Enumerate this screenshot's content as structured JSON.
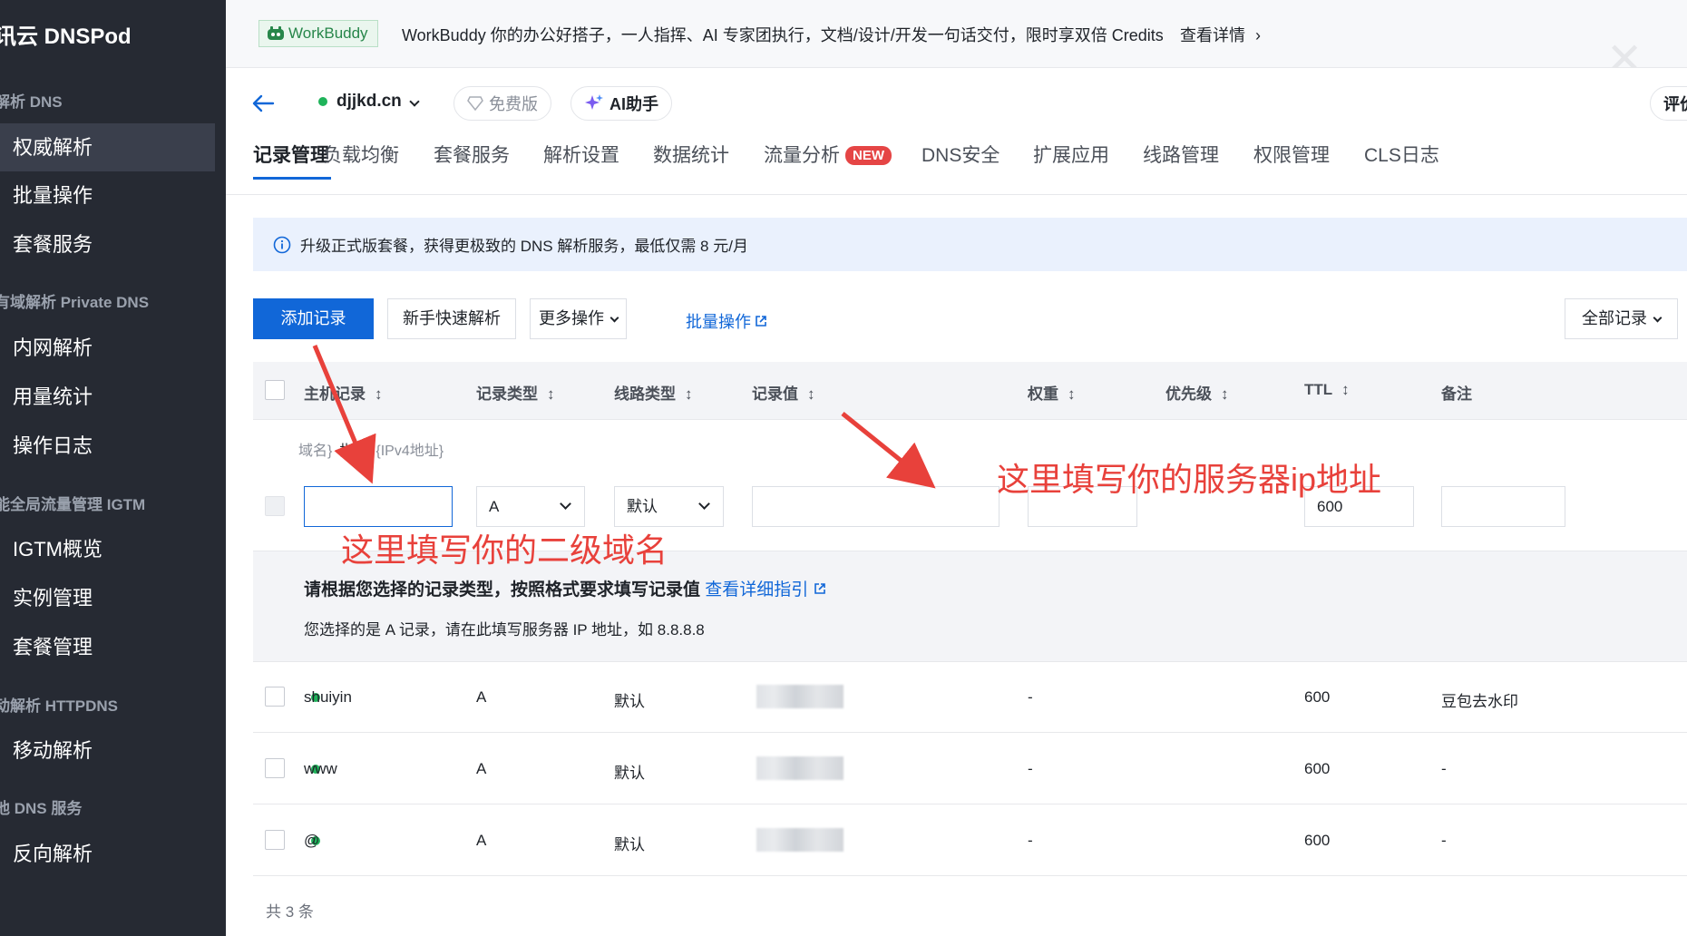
{
  "sidebar": {
    "title": "讯云 DNSPod",
    "groups": [
      {
        "label": "解析 DNS",
        "items": [
          {
            "label": "权威解析",
            "active": true
          },
          {
            "label": "批量操作"
          },
          {
            "label": "套餐服务"
          }
        ]
      },
      {
        "label": "有域解析 Private DNS",
        "items": [
          {
            "label": "内网解析"
          },
          {
            "label": "用量统计"
          },
          {
            "label": "操作日志"
          }
        ]
      },
      {
        "label": "能全局流量管理 IGTM",
        "items": [
          {
            "label": "IGTM概览"
          },
          {
            "label": "实例管理"
          },
          {
            "label": "套餐管理"
          }
        ]
      },
      {
        "label": "动解析 HTTPDNS",
        "items": [
          {
            "label": "移动解析"
          }
        ]
      },
      {
        "label": "他 DNS 服务",
        "items": [
          {
            "label": "反向解析"
          }
        ]
      }
    ]
  },
  "banner": {
    "badge": "WorkBuddy",
    "text": "WorkBuddy 你的办公好搭子，一人指挥、AI 专家团执行，文档/设计/开发一句话交付，限时享双倍 Credits",
    "link": "查看详情"
  },
  "header": {
    "domain": "djjkd.cn",
    "plan_pill": "免费版",
    "ai_pill": "AI助手",
    "eval_pill": "评价"
  },
  "tabs": [
    {
      "label": "记录管理",
      "active": true
    },
    {
      "label": "负载均衡"
    },
    {
      "label": "套餐服务"
    },
    {
      "label": "解析设置"
    },
    {
      "label": "数据统计"
    },
    {
      "label": "流量分析",
      "badge": "NEW"
    },
    {
      "label": "DNS安全"
    },
    {
      "label": "扩展应用"
    },
    {
      "label": "线路管理"
    },
    {
      "label": "权限管理"
    },
    {
      "label": "CLS日志"
    }
  ],
  "notice": "升级正式版套餐，获得更极致的 DNS 解析服务，最低仅需 8 元/月",
  "toolbar": {
    "add": "添加记录",
    "quick": "新手快速解析",
    "more": "更多操作",
    "batch": "批量操作",
    "filter": "全部记录"
  },
  "table": {
    "columns": [
      "主机记录",
      "记录类型",
      "线路类型",
      "记录值",
      "权重",
      "优先级",
      "TTL",
      "备注"
    ],
    "new_row": {
      "hint_prefix": "域名}",
      "hint_middle": "指向",
      "hint_suffix": "{IPv4地址}",
      "host_value": "",
      "type_value": "A",
      "line_value": "默认",
      "record_value": "",
      "weight_value": "",
      "ttl_value": "600",
      "remark_value": ""
    },
    "guide": {
      "title": "请根据您选择的记录类型，按照格式要求填写记录值",
      "link": "查看详细指引",
      "desc": "您选择的是 A 记录，请在此填写服务器 IP 地址，如 8.8.8.8"
    },
    "rows": [
      {
        "host": "shuiyin",
        "type": "A",
        "line": "默认",
        "weight": "-",
        "ttl": "600",
        "remark": "豆包去水印"
      },
      {
        "host": "www",
        "type": "A",
        "line": "默认",
        "weight": "-",
        "ttl": "600",
        "remark": "-"
      },
      {
        "host": "@",
        "type": "A",
        "line": "默认",
        "weight": "-",
        "ttl": "600",
        "remark": "-"
      }
    ],
    "total": "共 3 条"
  },
  "annotations": {
    "host_note": "这里填写你的二级域名",
    "ip_note": "这里填写你的服务器ip地址"
  },
  "colors": {
    "primary": "#1167d8",
    "sidebar_bg": "#262a33",
    "annotation": "#e8413b",
    "status_green": "#1fb35a"
  }
}
